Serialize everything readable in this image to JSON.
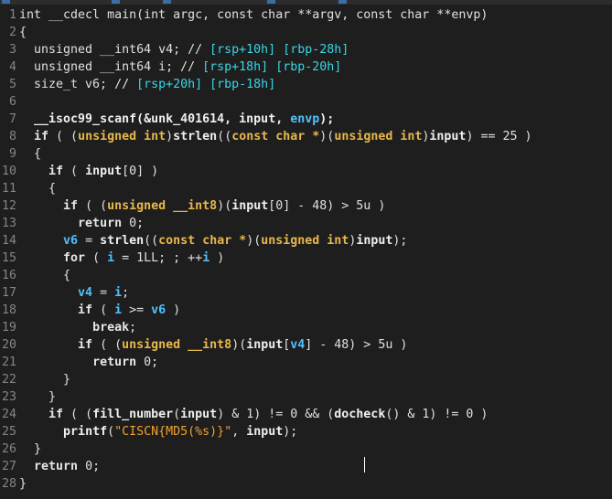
{
  "editor": {
    "lines": [
      {
        "n": "1",
        "tokens": [
          [
            "plain",
            "int __cdecl main(int argc, const char **argv, const char **envp)"
          ]
        ]
      },
      {
        "n": "2",
        "tokens": [
          [
            "plain",
            "{"
          ]
        ]
      },
      {
        "n": "3",
        "tokens": [
          [
            "plain",
            "  unsigned __int64 v4; // "
          ],
          [
            "cyan",
            "[rsp+10h] [rbp-28h]"
          ]
        ]
      },
      {
        "n": "4",
        "tokens": [
          [
            "plain",
            "  unsigned __int64 i; // "
          ],
          [
            "cyan",
            "[rsp+18h] [rbp-20h]"
          ]
        ]
      },
      {
        "n": "5",
        "tokens": [
          [
            "plain",
            "  size_t v6; // "
          ],
          [
            "cyan",
            "[rsp+20h] [rbp-18h]"
          ]
        ]
      },
      {
        "n": "6",
        "tokens": [
          [
            "plain",
            ""
          ]
        ]
      },
      {
        "n": "7",
        "tokens": [
          [
            "plain",
            "  "
          ],
          [
            "bold",
            "__isoc99_scanf(&unk_401614, input, "
          ],
          [
            "var",
            "envp"
          ],
          [
            "bold",
            ");"
          ]
        ]
      },
      {
        "n": "8",
        "tokens": [
          [
            "plain",
            "  "
          ],
          [
            "kw",
            "if"
          ],
          [
            "plain",
            " ( ("
          ],
          [
            "type",
            "unsigned int"
          ],
          [
            "plain",
            ")"
          ],
          [
            "bold",
            "strlen"
          ],
          [
            "plain",
            "(("
          ],
          [
            "type",
            "const char *"
          ],
          [
            "plain",
            ")("
          ],
          [
            "type",
            "unsigned int"
          ],
          [
            "plain",
            ")"
          ],
          [
            "bold",
            "input"
          ],
          [
            "plain",
            ") == 25 )"
          ]
        ]
      },
      {
        "n": "9",
        "tokens": [
          [
            "plain",
            "  {"
          ]
        ]
      },
      {
        "n": "10",
        "tokens": [
          [
            "plain",
            "    "
          ],
          [
            "kw",
            "if"
          ],
          [
            "plain",
            " ( "
          ],
          [
            "bold",
            "input"
          ],
          [
            "plain",
            "[0] )"
          ]
        ]
      },
      {
        "n": "11",
        "tokens": [
          [
            "plain",
            "    {"
          ]
        ]
      },
      {
        "n": "12",
        "tokens": [
          [
            "plain",
            "      "
          ],
          [
            "kw",
            "if"
          ],
          [
            "plain",
            " ( ("
          ],
          [
            "type",
            "unsigned __int8"
          ],
          [
            "plain",
            ")("
          ],
          [
            "bold",
            "input"
          ],
          [
            "plain",
            "[0] - 48) > 5u )"
          ]
        ]
      },
      {
        "n": "13",
        "tokens": [
          [
            "plain",
            "        "
          ],
          [
            "kw",
            "return"
          ],
          [
            "plain",
            " 0;"
          ]
        ]
      },
      {
        "n": "14",
        "tokens": [
          [
            "plain",
            "      "
          ],
          [
            "var",
            "v6"
          ],
          [
            "plain",
            " = "
          ],
          [
            "bold",
            "strlen"
          ],
          [
            "plain",
            "(("
          ],
          [
            "type",
            "const char *"
          ],
          [
            "plain",
            ")("
          ],
          [
            "type",
            "unsigned int"
          ],
          [
            "plain",
            ")"
          ],
          [
            "bold",
            "input"
          ],
          [
            "plain",
            ");"
          ]
        ]
      },
      {
        "n": "15",
        "tokens": [
          [
            "plain",
            "      "
          ],
          [
            "kw",
            "for"
          ],
          [
            "plain",
            " ( "
          ],
          [
            "var",
            "i"
          ],
          [
            "plain",
            " = 1LL; ; ++"
          ],
          [
            "var",
            "i"
          ],
          [
            "plain",
            " )"
          ]
        ]
      },
      {
        "n": "16",
        "tokens": [
          [
            "plain",
            "      {"
          ]
        ]
      },
      {
        "n": "17",
        "tokens": [
          [
            "plain",
            "        "
          ],
          [
            "var",
            "v4"
          ],
          [
            "plain",
            " = "
          ],
          [
            "var",
            "i"
          ],
          [
            "plain",
            ";"
          ]
        ]
      },
      {
        "n": "18",
        "tokens": [
          [
            "plain",
            "        "
          ],
          [
            "kw",
            "if"
          ],
          [
            "plain",
            " ( "
          ],
          [
            "var",
            "i"
          ],
          [
            "plain",
            " >= "
          ],
          [
            "var",
            "v6"
          ],
          [
            "plain",
            " )"
          ]
        ]
      },
      {
        "n": "19",
        "tokens": [
          [
            "plain",
            "          "
          ],
          [
            "kw",
            "break"
          ],
          [
            "plain",
            ";"
          ]
        ]
      },
      {
        "n": "20",
        "tokens": [
          [
            "plain",
            "        "
          ],
          [
            "kw",
            "if"
          ],
          [
            "plain",
            " ( ("
          ],
          [
            "type",
            "unsigned __int8"
          ],
          [
            "plain",
            ")("
          ],
          [
            "bold",
            "input"
          ],
          [
            "plain",
            "["
          ],
          [
            "var",
            "v4"
          ],
          [
            "plain",
            "] - 48) > 5u )"
          ]
        ]
      },
      {
        "n": "21",
        "tokens": [
          [
            "plain",
            "          "
          ],
          [
            "kw",
            "return"
          ],
          [
            "plain",
            " 0;"
          ]
        ]
      },
      {
        "n": "22",
        "tokens": [
          [
            "plain",
            "      }"
          ]
        ]
      },
      {
        "n": "23",
        "tokens": [
          [
            "plain",
            "    }"
          ]
        ]
      },
      {
        "n": "24",
        "tokens": [
          [
            "plain",
            "    "
          ],
          [
            "kw",
            "if"
          ],
          [
            "plain",
            " ( ("
          ],
          [
            "bold",
            "fill_number"
          ],
          [
            "plain",
            "("
          ],
          [
            "bold",
            "input"
          ],
          [
            "plain",
            ") & 1) != 0 && ("
          ],
          [
            "bold",
            "docheck"
          ],
          [
            "plain",
            "() & 1) != 0 )"
          ]
        ]
      },
      {
        "n": "25",
        "tokens": [
          [
            "plain",
            "      "
          ],
          [
            "bold",
            "printf"
          ],
          [
            "plain",
            "("
          ],
          [
            "str",
            "\"CISCN{MD5(%s)}\""
          ],
          [
            "plain",
            ", "
          ],
          [
            "bold",
            "input"
          ],
          [
            "plain",
            ");"
          ]
        ]
      },
      {
        "n": "26",
        "tokens": [
          [
            "plain",
            "  }"
          ]
        ]
      },
      {
        "n": "27",
        "tokens": [
          [
            "plain",
            "  "
          ],
          [
            "kw",
            "return"
          ],
          [
            "plain",
            " 0;"
          ]
        ]
      },
      {
        "n": "28",
        "tokens": [
          [
            "plain",
            "}"
          ]
        ]
      }
    ]
  }
}
